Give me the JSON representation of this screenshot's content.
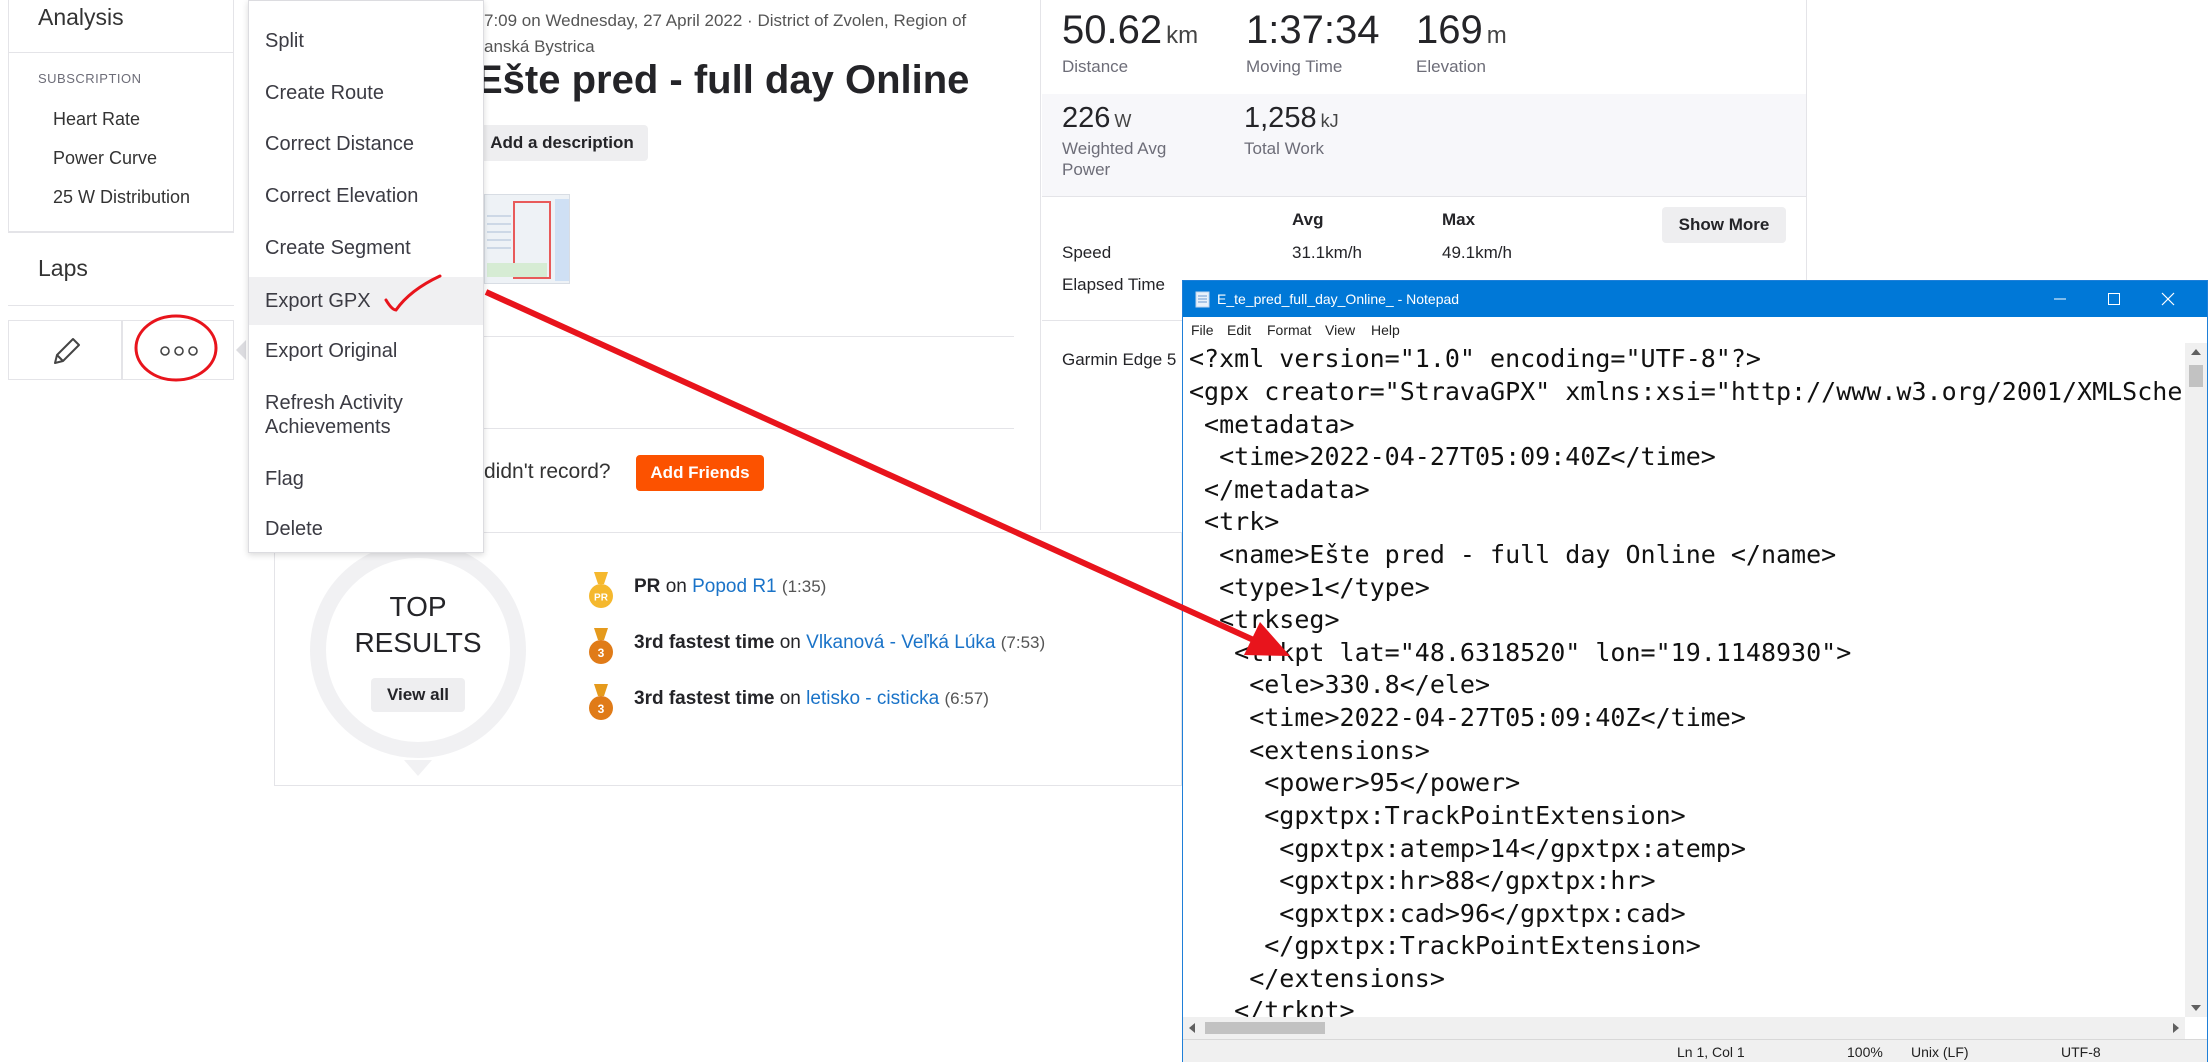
{
  "sidebar": {
    "analysis": "Analysis",
    "subscription": "SUBSCRIPTION",
    "items": [
      "Heart Rate",
      "Power Curve",
      "25 W Distribution"
    ],
    "laps": "Laps"
  },
  "menu": {
    "items": [
      "Split",
      "Create Route",
      "Correct Distance",
      "Correct Elevation",
      "Create Segment",
      "Export GPX",
      "Export Original",
      "Refresh Activity Achievements",
      "Flag",
      "Delete"
    ]
  },
  "activity": {
    "meta_line1": "7:09 on Wednesday, 27 April 2022 · District of Zvolen, Region of",
    "meta_line2": "anská Bystrica",
    "title": "Ešte pred - full day Online",
    "add_description": "Add a description",
    "friends_prompt": "didn't record?",
    "add_friends": "Add Friends"
  },
  "stats": {
    "distance": {
      "value": "50.62",
      "unit": "km",
      "label": "Distance"
    },
    "moving_time": {
      "value": "1:37:34",
      "label": "Moving Time"
    },
    "elevation": {
      "value": "169",
      "unit": "m",
      "label": "Elevation"
    },
    "weighted_power": {
      "value": "226",
      "unit": "W",
      "label_1": "Weighted Avg",
      "label_2": "Power"
    },
    "total_work": {
      "value": "1,258",
      "unit": "kJ",
      "label": "Total Work"
    },
    "table": {
      "avg_header": "Avg",
      "max_header": "Max",
      "show_more": "Show More",
      "speed_label": "Speed",
      "speed_avg": "31.1km/h",
      "speed_max": "49.1km/h",
      "elapsed_label": "Elapsed Time",
      "device": "Garmin Edge 5"
    }
  },
  "results": {
    "title_1": "TOP",
    "title_2": "RESULTS",
    "view_all": "View all",
    "rows": [
      {
        "badge": "PR",
        "label": "PR",
        "on": "on",
        "segment": "Popod R1",
        "time": "(1:35)"
      },
      {
        "badge": "3",
        "label": "3rd fastest time",
        "on": "on",
        "segment": "Vlkanová - Veľká Lúka",
        "time": "(7:53)"
      },
      {
        "badge": "3",
        "label": "3rd fastest time",
        "on": "on",
        "segment": "letisko - cisticka",
        "time": "(6:57)"
      }
    ]
  },
  "notepad": {
    "title": "E_te_pred_full_day_Online_ - Notepad",
    "menu": [
      "File",
      "Edit",
      "Format",
      "View",
      "Help"
    ],
    "lines": [
      "<?xml version=\"1.0\" encoding=\"UTF-8\"?>",
      "<gpx creator=\"StravaGPX\" xmlns:xsi=\"http://www.w3.org/2001/XMLSche",
      " <metadata>",
      "  <time>2022-04-27T05:09:40Z</time>",
      " </metadata>",
      " <trk>",
      "  <name>Ešte pred - full day Online </name>",
      "  <type>1</type>",
      "  <trkseg>",
      "   <trkpt lat=\"48.6318520\" lon=\"19.1148930\">",
      "    <ele>330.8</ele>",
      "    <time>2022-04-27T05:09:40Z</time>",
      "    <extensions>",
      "     <power>95</power>",
      "     <gpxtpx:TrackPointExtension>",
      "      <gpxtpx:atemp>14</gpxtpx:atemp>",
      "      <gpxtpx:hr>88</gpxtpx:hr>",
      "      <gpxtpx:cad>96</gpxtpx:cad>",
      "     </gpxtpx:TrackPointExtension>",
      "    </extensions>",
      "   </trkpt>"
    ],
    "status": {
      "position": "Ln 1, Col 1",
      "zoom": "100%",
      "line_ending": "Unix (LF)",
      "encoding": "UTF-8"
    }
  },
  "colors": {
    "strava_orange": "#fc5200",
    "annotation_red": "#e8141c",
    "link_blue": "#1a73c8",
    "notepad_blue": "#0078d7"
  }
}
